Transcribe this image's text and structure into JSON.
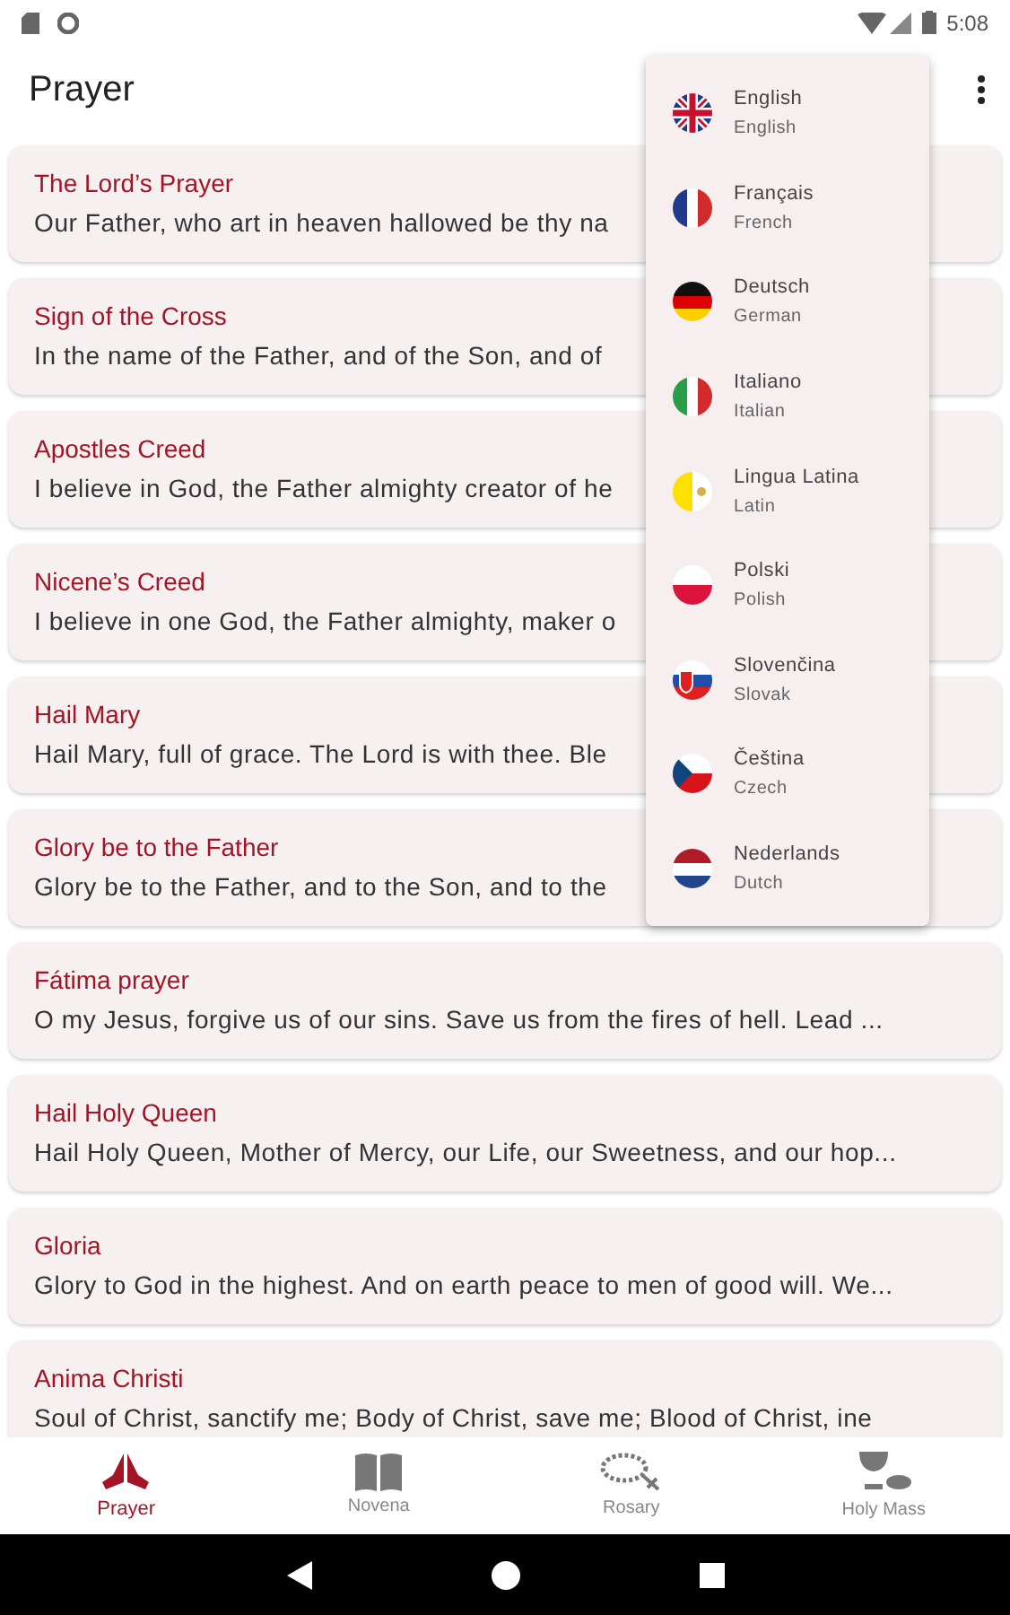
{
  "status_bar": {
    "time": "5:08"
  },
  "app_bar": {
    "title": "Prayer"
  },
  "prayers": [
    {
      "title": "The Lord’s Prayer",
      "text": "Our Father, who art in heaven hallowed be thy na"
    },
    {
      "title": "Sign of the Cross",
      "text": "In the name of the Father, and of the Son, and of"
    },
    {
      "title": "Apostles Creed",
      "text": "I believe in God, the Father almighty creator of he"
    },
    {
      "title": "Nicene’s Creed",
      "text": "I believe in one God, the Father almighty, maker o"
    },
    {
      "title": "Hail Mary",
      "text": "Hail Mary, full of grace. The Lord is with thee. Ble"
    },
    {
      "title": "Glory be to the Father",
      "text": "Glory be to the Father, and to the Son, and to the"
    },
    {
      "title": "Fátima prayer",
      "text": "O my Jesus, forgive us of our sins. Save us from the fires of hell. Lead ..."
    },
    {
      "title": "Hail Holy Queen",
      "text": "Hail Holy Queen, Mother of Mercy, our Life, our Sweetness, and our hop..."
    },
    {
      "title": "Gloria",
      "text": "Glory to God in the highest. And on earth peace to men of good will. We..."
    },
    {
      "title": "Anima Christi",
      "text": "Soul of Christ, sanctify me; Body of Christ, save me; Blood of Christ, ine"
    }
  ],
  "language_menu": [
    {
      "name": "English",
      "english": "English"
    },
    {
      "name": "Français",
      "english": "French"
    },
    {
      "name": "Deutsch",
      "english": "German"
    },
    {
      "name": "Italiano",
      "english": "Italian"
    },
    {
      "name": "Lingua Latina",
      "english": "Latin"
    },
    {
      "name": "Polski",
      "english": "Polish"
    },
    {
      "name": "Slovenčina",
      "english": "Slovak"
    },
    {
      "name": "Čeština",
      "english": "Czech"
    },
    {
      "name": "Nederlands",
      "english": "Dutch"
    }
  ],
  "bottom_nav": [
    {
      "label": "Prayer",
      "selected": true
    },
    {
      "label": "Novena",
      "selected": false
    },
    {
      "label": "Rosary",
      "selected": false
    },
    {
      "label": "Holy Mass",
      "selected": false
    }
  ]
}
